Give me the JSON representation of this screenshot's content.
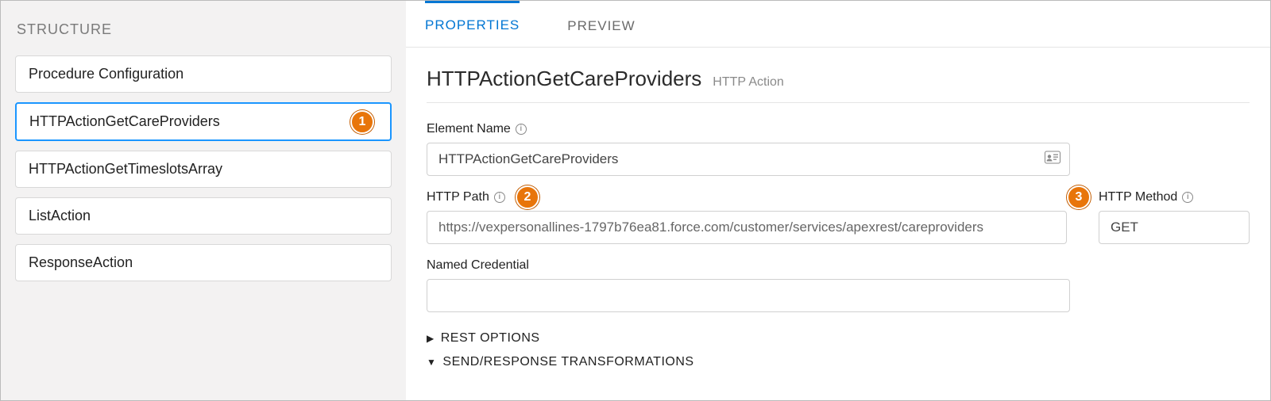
{
  "sidebar": {
    "title": "STRUCTURE",
    "items": [
      {
        "label": "Procedure Configuration",
        "selected": false
      },
      {
        "label": "HTTPActionGetCareProviders",
        "selected": true
      },
      {
        "label": "HTTPActionGetTimeslotsArray",
        "selected": false
      },
      {
        "label": "ListAction",
        "selected": false
      },
      {
        "label": "ResponseAction",
        "selected": false
      }
    ]
  },
  "tabs": {
    "properties": "PROPERTIES",
    "preview": "PREVIEW"
  },
  "properties": {
    "title": "HTTPActionGetCareProviders",
    "subtitle": "HTTP Action",
    "element_name_label": "Element Name",
    "element_name_value": "HTTPActionGetCareProviders",
    "http_path_label": "HTTP Path",
    "http_path_value": "https://vexpersonallines-1797b76ea81.force.com/customer/services/apexrest/careproviders",
    "http_method_label": "HTTP Method",
    "http_method_value": "GET",
    "named_credential_label": "Named Credential",
    "named_credential_value": "",
    "section_rest_options": "REST OPTIONS",
    "section_send_response": "SEND/RESPONSE TRANSFORMATIONS"
  },
  "badges": {
    "b1": "1",
    "b2": "2",
    "b3": "3"
  }
}
